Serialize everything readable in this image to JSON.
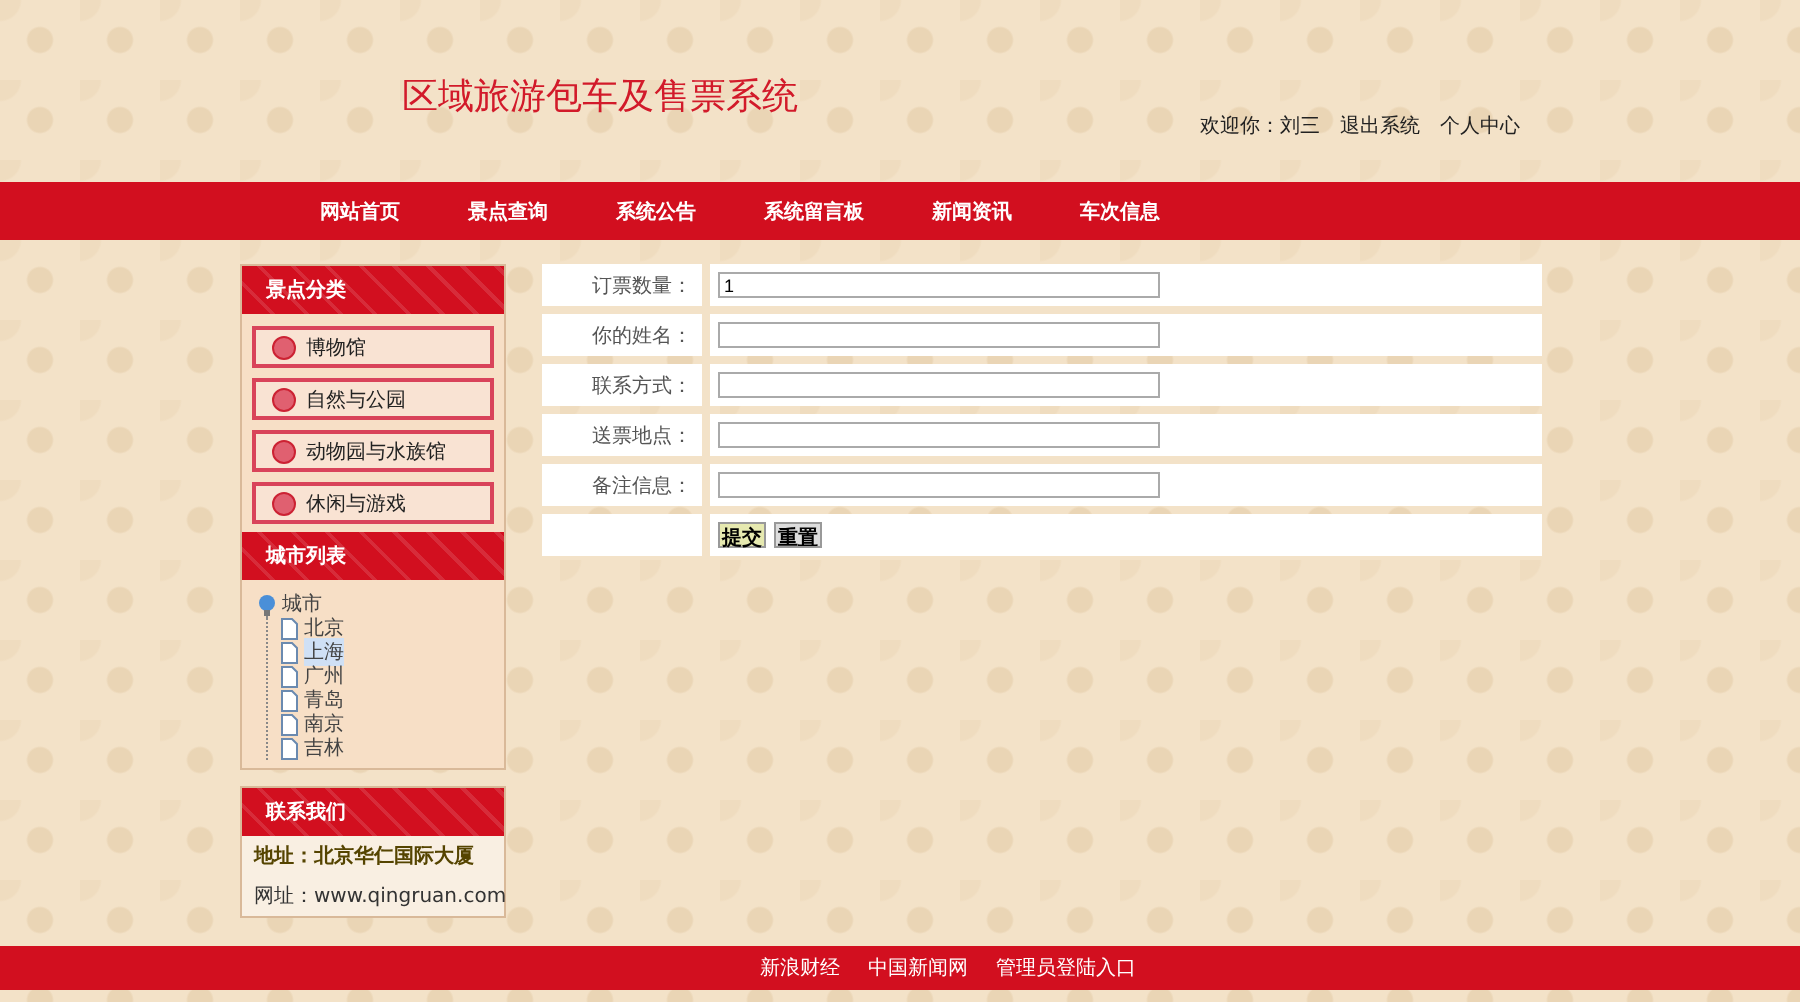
{
  "header": {
    "title": "区域旅游包车及售票系统",
    "user_links": [
      {
        "label": "欢迎你：刘三"
      },
      {
        "label": "退出系统"
      },
      {
        "label": "个人中心"
      }
    ]
  },
  "nav": {
    "items": [
      {
        "label": "网站首页"
      },
      {
        "label": "景点查询"
      },
      {
        "label": "系统公告"
      },
      {
        "label": "系统留言板"
      },
      {
        "label": "新闻资讯"
      },
      {
        "label": "车次信息"
      }
    ]
  },
  "sidebar": {
    "categories": {
      "title": "景点分类",
      "items": [
        {
          "label": "博物馆"
        },
        {
          "label": "自然与公园"
        },
        {
          "label": "动物园与水族馆"
        },
        {
          "label": "休闲与游戏"
        }
      ]
    },
    "cities": {
      "title": "城市列表",
      "tree": [
        {
          "label": "城市",
          "expanded": true,
          "selected": false,
          "children": [
            {
              "label": "北京",
              "selected": false
            },
            {
              "label": "上海",
              "selected": true
            },
            {
              "label": "广州",
              "selected": false
            },
            {
              "label": "青岛",
              "selected": false
            },
            {
              "label": "南京",
              "selected": false
            },
            {
              "label": "吉林",
              "selected": false
            }
          ]
        }
      ]
    },
    "contact": {
      "title": "联系我们",
      "lines": [
        {
          "kind": "address",
          "text": "地址：北京华仁国际大厦"
        },
        {
          "kind": "website",
          "text": "网址：www.qingruan.com"
        }
      ]
    }
  },
  "form": {
    "fields": [
      {
        "label": "订票数量：",
        "value": "1"
      },
      {
        "label": "你的姓名："
      },
      {
        "label": "联系方式："
      },
      {
        "label": "送票地点："
      },
      {
        "label": "备注信息："
      }
    ],
    "buttons": [
      {
        "label": "提交",
        "kind": "submit"
      },
      {
        "label": "重置",
        "kind": "reset"
      }
    ]
  },
  "footer": {
    "links": [
      {
        "label": "新浪财经"
      },
      {
        "label": "中国新闻网"
      },
      {
        "label": "管理员登陆入口"
      }
    ]
  }
}
